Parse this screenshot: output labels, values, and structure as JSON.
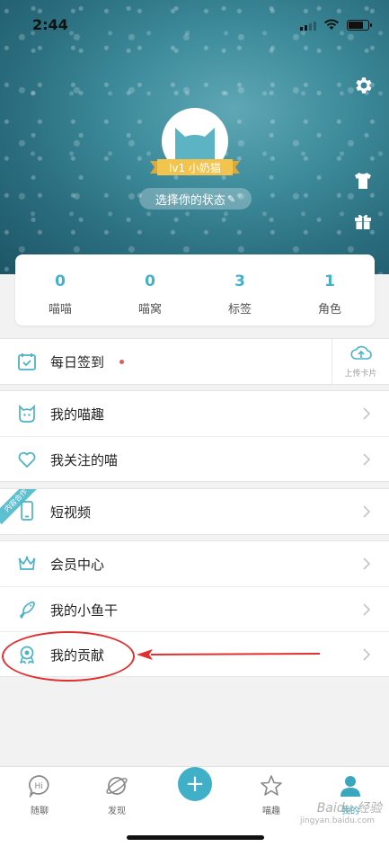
{
  "status_bar": {
    "time": "2:44"
  },
  "profile": {
    "level_badge": "lv1 小奶猫",
    "status_prompt": "选择你的状态",
    "status_edit_glyph": "✎"
  },
  "stats": [
    {
      "value": "0",
      "label": "喵喵"
    },
    {
      "value": "0",
      "label": "喵窝"
    },
    {
      "value": "3",
      "label": "标签"
    },
    {
      "value": "1",
      "label": "角色"
    }
  ],
  "checkin": {
    "label": "每日签到",
    "upload_label": "上传卡片"
  },
  "group1": [
    {
      "label": "我的喵趣",
      "icon": "cat-face-icon"
    },
    {
      "label": "我关注的喵",
      "icon": "heart-icon"
    }
  ],
  "video": {
    "label": "短视频",
    "tag": "内容合作",
    "icon": "phone-icon"
  },
  "group3": [
    {
      "label": "会员中心",
      "icon": "crown-icon"
    },
    {
      "label": "我的小鱼干",
      "icon": "fish-icon"
    },
    {
      "label": "我的贡献",
      "icon": "medal-icon"
    }
  ],
  "tabbar": {
    "items": [
      {
        "label": "随聊",
        "icon": "chat-hi-icon"
      },
      {
        "label": "发现",
        "icon": "planet-icon"
      },
      {
        "label": "喵趣",
        "icon": "star-icon"
      },
      {
        "label": "我的",
        "icon": "person-icon",
        "active": true
      }
    ],
    "center_glyph": "+"
  },
  "watermark": {
    "brand": "Baidu 经验",
    "sub": "jingyan.baidu.com"
  },
  "colors": {
    "accent": "#44b2c6",
    "annotation": "#e03030",
    "ribbon": "#f2c44e"
  }
}
